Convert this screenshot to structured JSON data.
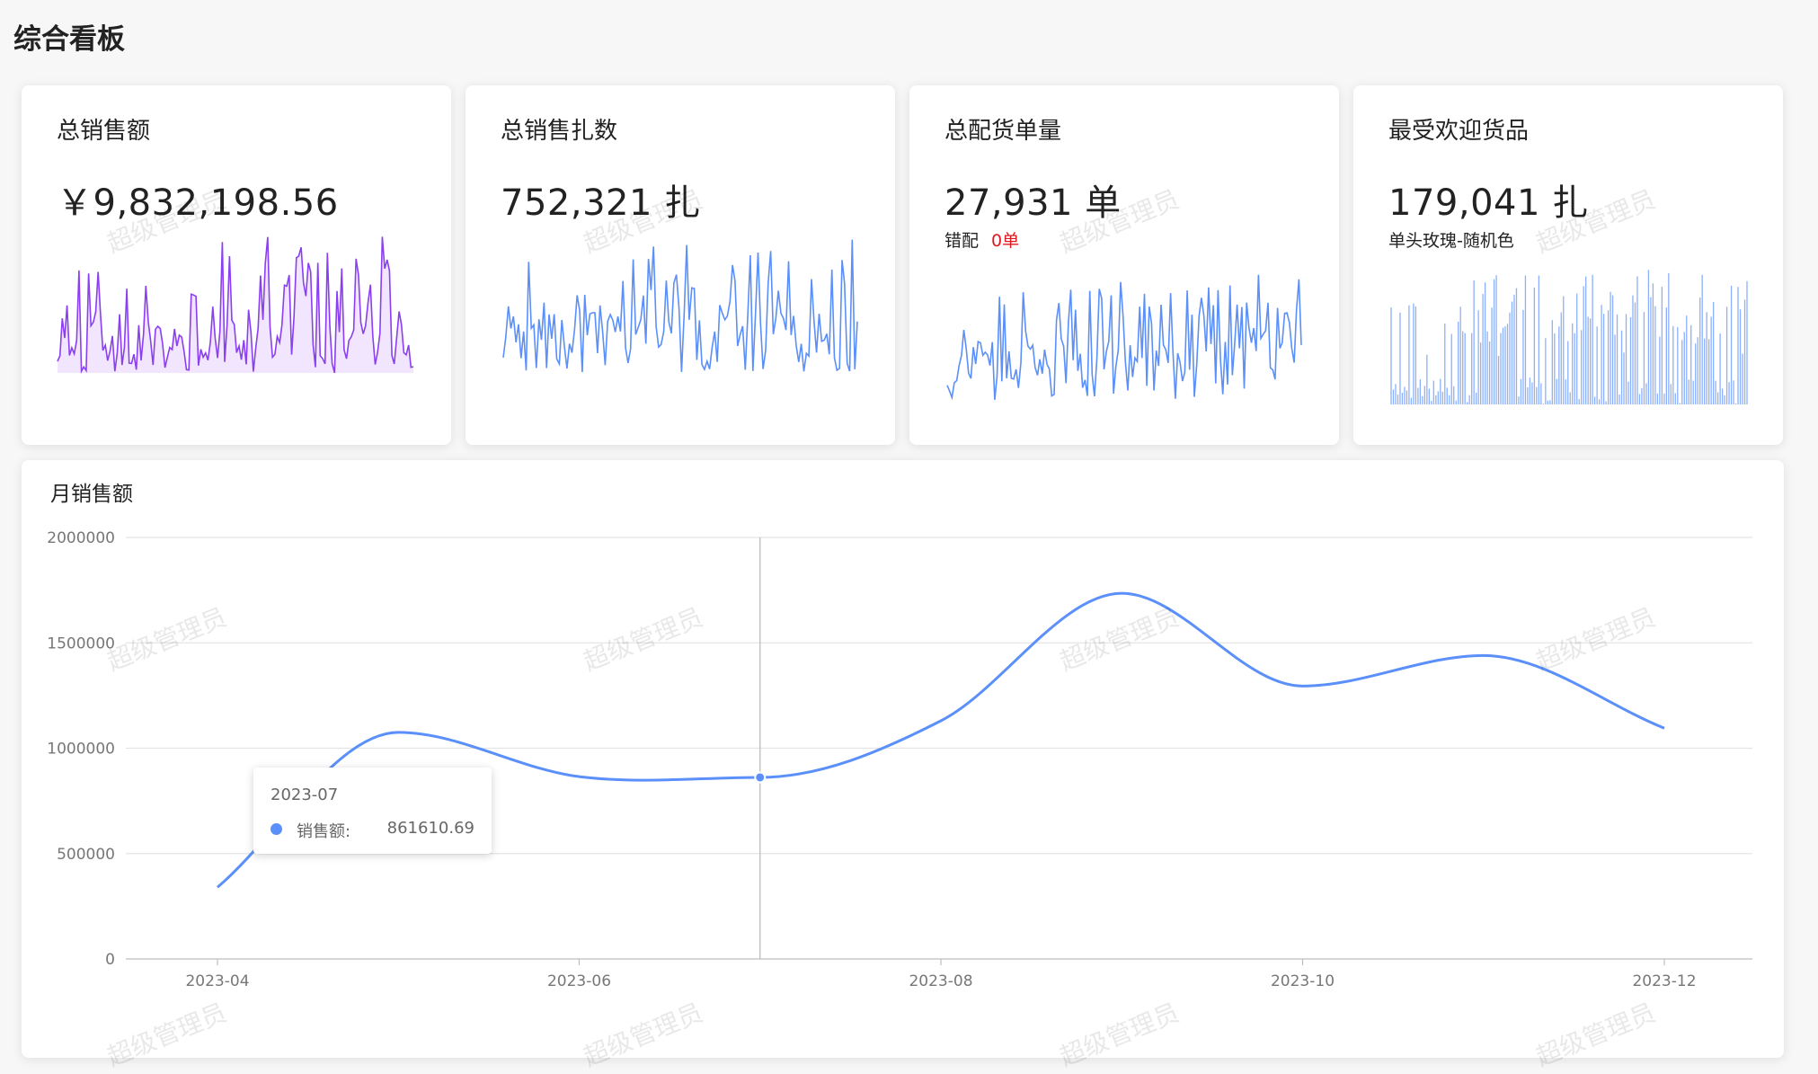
{
  "page_title": "综合看板",
  "watermark": "超级管理员",
  "kpis": [
    {
      "title": "总销售额",
      "value": "￥9,832,198.56",
      "color": "#8a3ff1",
      "fill": "#f1e6fd"
    },
    {
      "title": "总销售扎数",
      "value": "752,321 扎",
      "color": "#5b8ff9"
    },
    {
      "title": "总配货单量",
      "value": "27,931 单",
      "sub_label": "错配",
      "sub_value": "0单",
      "color": "#5b8ff9"
    },
    {
      "title": "最受欢迎货品",
      "value": "179,041 扎",
      "sub_label": "单头玫瑰-随机色",
      "color": "#5b8ff9"
    }
  ],
  "monthly": {
    "title": "月销售额",
    "tooltip": {
      "date": "2023-07",
      "name": "销售额:",
      "value": "861610.69"
    }
  },
  "chart_data": {
    "type": "line",
    "title": "月销售额",
    "x": [
      "2023-04",
      "2023-05",
      "2023-06",
      "2023-07",
      "2023-08",
      "2023-09",
      "2023-10",
      "2023-11",
      "2023-12"
    ],
    "x_tick_labels": [
      "2023-04",
      "2023-06",
      "2023-08",
      "2023-10",
      "2023-12"
    ],
    "series": [
      {
        "name": "销售额",
        "values": [
          340000,
          1075000,
          865000,
          861610.69,
          1130000,
          1735000,
          1295000,
          1440000,
          1095000
        ]
      }
    ],
    "ylim": [
      0,
      2000000
    ],
    "y_ticks": [
      0,
      500000,
      1000000,
      1500000,
      2000000
    ],
    "grid": true,
    "color": "#5b8ff9",
    "highlight_index": 3
  }
}
